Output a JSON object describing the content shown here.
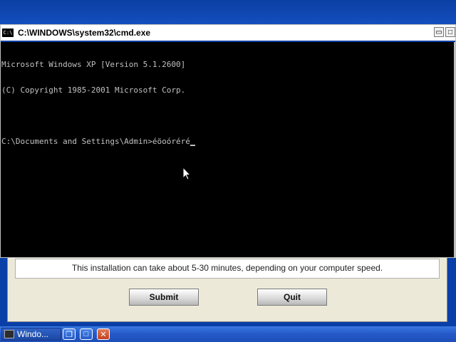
{
  "cmd_window": {
    "title": "C:\\WINDOWS\\system32\\cmd.exe",
    "icon": "cmd-icon",
    "lines": [
      "Microsoft Windows XP [Version 5.1.2600]",
      "(C) Copyright 1985-2001 Microsoft Corp.",
      "",
      "C:\\Documents and Settings\\Admin>éöoóréré"
    ]
  },
  "installer": {
    "message": "This installation can take about 5-30 minutes, depending on your computer speed.",
    "submit_label": "Submit",
    "quit_label": "Quit"
  },
  "taskbar": {
    "item_label": "Windo...",
    "icons": [
      "restore-icon",
      "maximize-icon",
      "close-icon"
    ]
  }
}
